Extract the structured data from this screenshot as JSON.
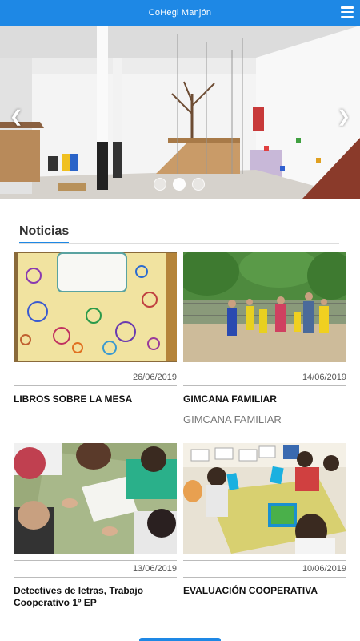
{
  "header": {
    "title": "CoHegi Manjón"
  },
  "carousel": {
    "slide_count": 3,
    "active_index": 1
  },
  "news": {
    "heading": "Noticias",
    "items": [
      {
        "date": "26/06/2019",
        "title": "LIBROS SOBRE LA MESA",
        "subtitle": ""
      },
      {
        "date": "14/06/2019",
        "title": "GIMCANA FAMILIAR",
        "subtitle": "GIMCANA FAMILIAR"
      },
      {
        "date": "13/06/2019",
        "title": "Detectives de letras, Trabajo Cooperativo 1º EP",
        "subtitle": ""
      },
      {
        "date": "10/06/2019",
        "title": "EVALUACIÓN COOPERATIVA",
        "subtitle": ""
      }
    ]
  },
  "colors": {
    "accent": "#1e88e5"
  }
}
